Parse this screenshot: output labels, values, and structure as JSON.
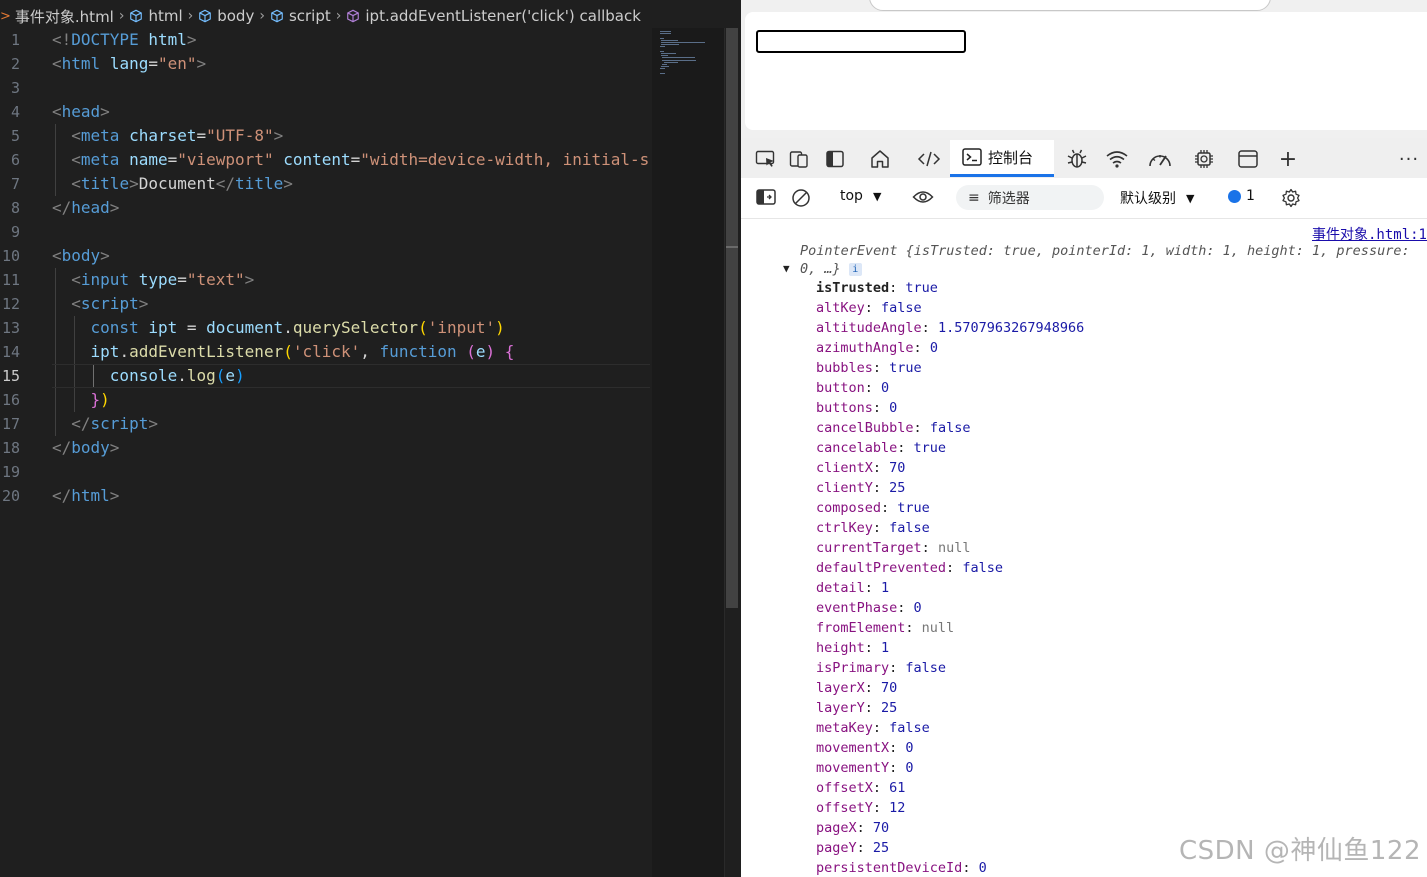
{
  "editor": {
    "breadcrumb": [
      "事件对象.html",
      "html",
      "body",
      "script",
      "ipt.addEventListener('click') callback"
    ],
    "active_line": 15,
    "lines": [
      [
        [
          "t-br",
          "<!"
        ],
        [
          "t-tag",
          "DOCTYPE "
        ],
        [
          "t-attr",
          "html"
        ],
        [
          "t-br",
          ">"
        ]
      ],
      [
        [
          "t-br",
          "<"
        ],
        [
          "t-tag",
          "html "
        ],
        [
          "t-attr",
          "lang"
        ],
        [
          "t-txt",
          "="
        ],
        [
          "t-str",
          "\"en\""
        ],
        [
          "t-br",
          ">"
        ]
      ],
      [],
      [
        [
          "t-br",
          "<"
        ],
        [
          "t-tag",
          "head"
        ],
        [
          "t-br",
          ">"
        ]
      ],
      [
        [
          "t-txt",
          "  "
        ],
        [
          "t-br",
          "<"
        ],
        [
          "t-tag",
          "meta "
        ],
        [
          "t-attr",
          "charset"
        ],
        [
          "t-txt",
          "="
        ],
        [
          "t-str",
          "\"UTF-8\""
        ],
        [
          "t-br",
          ">"
        ]
      ],
      [
        [
          "t-txt",
          "  "
        ],
        [
          "t-br",
          "<"
        ],
        [
          "t-tag",
          "meta "
        ],
        [
          "t-attr",
          "name"
        ],
        [
          "t-txt",
          "="
        ],
        [
          "t-str",
          "\"viewport\" "
        ],
        [
          "t-attr",
          "content"
        ],
        [
          "t-txt",
          "="
        ],
        [
          "t-str",
          "\"width=device-width, initial-sc"
        ]
      ],
      [
        [
          "t-txt",
          "  "
        ],
        [
          "t-br",
          "<"
        ],
        [
          "t-tag",
          "title"
        ],
        [
          "t-br",
          ">"
        ],
        [
          "t-txt",
          "Document"
        ],
        [
          "t-br",
          "</"
        ],
        [
          "t-tag",
          "title"
        ],
        [
          "t-br",
          ">"
        ]
      ],
      [
        [
          "t-br",
          "</"
        ],
        [
          "t-tag",
          "head"
        ],
        [
          "t-br",
          ">"
        ]
      ],
      [],
      [
        [
          "t-br",
          "<"
        ],
        [
          "t-tag",
          "body"
        ],
        [
          "t-br",
          ">"
        ]
      ],
      [
        [
          "t-txt",
          "  "
        ],
        [
          "t-br",
          "<"
        ],
        [
          "t-tag",
          "input "
        ],
        [
          "t-attr",
          "type"
        ],
        [
          "t-txt",
          "="
        ],
        [
          "t-str",
          "\"text\""
        ],
        [
          "t-br",
          ">"
        ]
      ],
      [
        [
          "t-txt",
          "  "
        ],
        [
          "t-br",
          "<"
        ],
        [
          "t-tag",
          "script"
        ],
        [
          "t-br",
          ">"
        ]
      ],
      [
        [
          "t-txt",
          "    "
        ],
        [
          "t-kw",
          "const "
        ],
        [
          "t-attr",
          "ipt "
        ],
        [
          "t-txt",
          "= "
        ],
        [
          "t-attr",
          "document"
        ],
        [
          "t-txt",
          "."
        ],
        [
          "t-fn",
          "querySelector"
        ],
        [
          "t-p2",
          "("
        ],
        [
          "t-str",
          "'input'"
        ],
        [
          "t-p2",
          ")"
        ]
      ],
      [
        [
          "t-txt",
          "    "
        ],
        [
          "t-attr",
          "ipt"
        ],
        [
          "t-txt",
          "."
        ],
        [
          "t-fn",
          "addEventListener"
        ],
        [
          "t-p2",
          "("
        ],
        [
          "t-str",
          "'click'"
        ],
        [
          "t-txt",
          ", "
        ],
        [
          "t-kw",
          "function "
        ],
        [
          "t-p1",
          "("
        ],
        [
          "t-attr",
          "e"
        ],
        [
          "t-p1",
          ") {"
        ]
      ],
      [
        [
          "t-txt",
          "      "
        ],
        [
          "t-attr",
          "console"
        ],
        [
          "t-txt",
          "."
        ],
        [
          "t-fn",
          "log"
        ],
        [
          "t-p3",
          "("
        ],
        [
          "t-attr",
          "e"
        ],
        [
          "t-p3",
          ")"
        ]
      ],
      [
        [
          "t-txt",
          "    "
        ],
        [
          "t-p1",
          "}"
        ],
        [
          "t-p2",
          ")"
        ]
      ],
      [
        [
          "t-txt",
          "  "
        ],
        [
          "t-br",
          "</"
        ],
        [
          "t-tag",
          "script"
        ],
        [
          "t-br",
          ">"
        ]
      ],
      [
        [
          "t-br",
          "</"
        ],
        [
          "t-tag",
          "body"
        ],
        [
          "t-br",
          ">"
        ]
      ],
      [],
      [
        [
          "t-br",
          "</"
        ],
        [
          "t-tag",
          "html"
        ],
        [
          "t-br",
          ">"
        ]
      ]
    ]
  },
  "devtools": {
    "tab_console_label": "控制台",
    "toolbar": {
      "context": "top",
      "filter_label": "筛选器",
      "level": "默认级别",
      "issues_count": "1"
    },
    "console": {
      "source_link": "事件对象.html:1",
      "summary_line1": "PointerEvent {isTrusted: true, pointerId: 1, width: 1, height: 1, pressure:",
      "summary_line2": "0, …}",
      "info_badge": "i",
      "properties": [
        {
          "key": "isTrusted",
          "value": "true",
          "type": "bool",
          "own": true
        },
        {
          "key": "altKey",
          "value": "false",
          "type": "bool"
        },
        {
          "key": "altitudeAngle",
          "value": "1.5707963267948966",
          "type": "num"
        },
        {
          "key": "azimuthAngle",
          "value": "0",
          "type": "num"
        },
        {
          "key": "bubbles",
          "value": "true",
          "type": "bool"
        },
        {
          "key": "button",
          "value": "0",
          "type": "num"
        },
        {
          "key": "buttons",
          "value": "0",
          "type": "num"
        },
        {
          "key": "cancelBubble",
          "value": "false",
          "type": "bool"
        },
        {
          "key": "cancelable",
          "value": "true",
          "type": "bool"
        },
        {
          "key": "clientX",
          "value": "70",
          "type": "num"
        },
        {
          "key": "clientY",
          "value": "25",
          "type": "num"
        },
        {
          "key": "composed",
          "value": "true",
          "type": "bool"
        },
        {
          "key": "ctrlKey",
          "value": "false",
          "type": "bool"
        },
        {
          "key": "currentTarget",
          "value": "null",
          "type": "null"
        },
        {
          "key": "defaultPrevented",
          "value": "false",
          "type": "bool"
        },
        {
          "key": "detail",
          "value": "1",
          "type": "num"
        },
        {
          "key": "eventPhase",
          "value": "0",
          "type": "num"
        },
        {
          "key": "fromElement",
          "value": "null",
          "type": "null"
        },
        {
          "key": "height",
          "value": "1",
          "type": "num"
        },
        {
          "key": "isPrimary",
          "value": "false",
          "type": "bool"
        },
        {
          "key": "layerX",
          "value": "70",
          "type": "num"
        },
        {
          "key": "layerY",
          "value": "25",
          "type": "num"
        },
        {
          "key": "metaKey",
          "value": "false",
          "type": "bool"
        },
        {
          "key": "movementX",
          "value": "0",
          "type": "num"
        },
        {
          "key": "movementY",
          "value": "0",
          "type": "num"
        },
        {
          "key": "offsetX",
          "value": "61",
          "type": "num"
        },
        {
          "key": "offsetY",
          "value": "12",
          "type": "num"
        },
        {
          "key": "pageX",
          "value": "70",
          "type": "num"
        },
        {
          "key": "pageY",
          "value": "25",
          "type": "num"
        },
        {
          "key": "persistentDeviceId",
          "value": "0",
          "type": "num"
        }
      ]
    }
  },
  "watermark": "CSDN @神仙鱼122"
}
